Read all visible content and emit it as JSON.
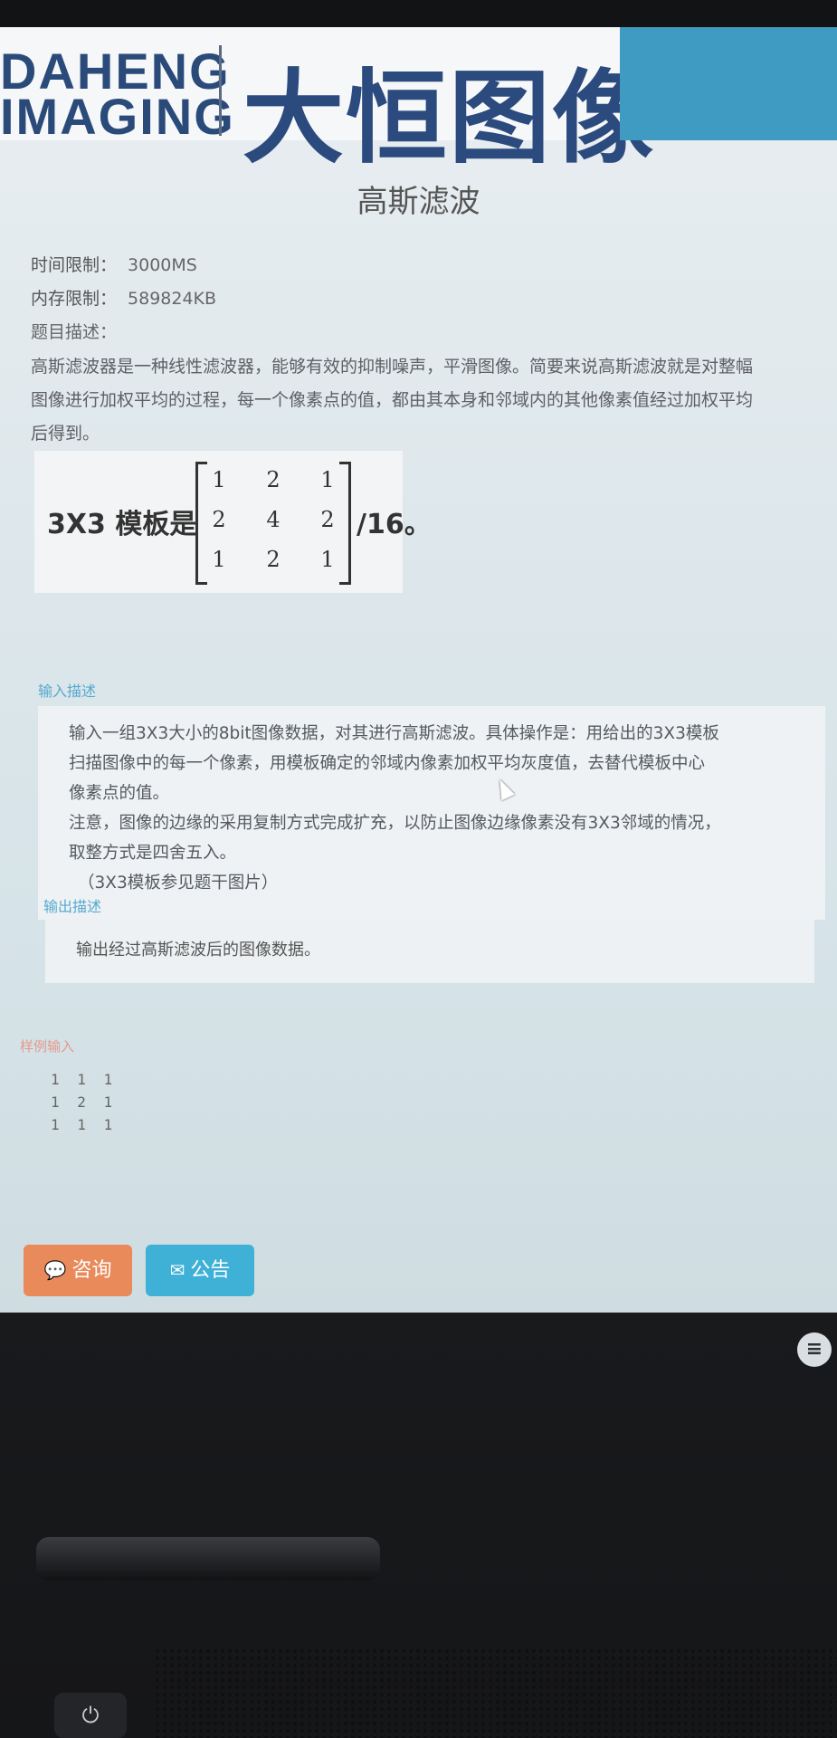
{
  "banner": {
    "logo_en_line1": "DAHENG",
    "logo_en_line2": "IMAGING",
    "logo_cn": "大恒图像",
    "accent_color": "#3f9bc1"
  },
  "problem": {
    "title": "高斯滤波",
    "time_limit_label": "时间限制：",
    "time_limit_value": "3000MS",
    "memory_limit_label": "内存限制：",
    "memory_limit_value": "589824KB",
    "description_label": "题目描述：",
    "description_lines": [
      "高斯滤波器是一种线性滤波器，能够有效的抑制噪声，平滑图像。简要来说高斯滤波就是对整幅",
      "图像进行加权平均的过程，每一个像素点的值，都由其本身和邻域内的其他像素值经过加权平均",
      "后得到。"
    ],
    "matrix_label": "3X3 模板是",
    "matrix": [
      [
        1,
        2,
        1
      ],
      [
        2,
        4,
        2
      ],
      [
        1,
        2,
        1
      ]
    ],
    "matrix_suffix": "/16。"
  },
  "input_section": {
    "label": "输入描述",
    "lines": [
      "输入一组3X3大小的8bit图像数据，对其进行高斯滤波。具体操作是：用给出的3X3模板",
      "扫描图像中的每一个像素，用模板确定的邻域内像素加权平均灰度值，去替代模板中心",
      "像素点的值。",
      "注意，图像的边缘的采用复制方式完成扩充，以防止图像边缘像素没有3X3邻域的情况，",
      "取整方式是四舍五入。",
      "（3X3模板参见题干图片）"
    ]
  },
  "output_section": {
    "label": "输出描述",
    "text": "输出经过高斯滤波后的图像数据。"
  },
  "sample_input": {
    "label": "样例输入",
    "rows": [
      "1 1 1",
      "1 2 1",
      "1 1 1"
    ]
  },
  "buttons": {
    "consult": {
      "label": "咨询",
      "icon": "chat-icon",
      "color": "#e88a5a"
    },
    "notice": {
      "label": "公告",
      "icon": "envelope-icon",
      "color": "#3fb0d6"
    }
  },
  "laptop": {
    "power_icon": "power-icon",
    "settings_icon": "settings-icon"
  }
}
